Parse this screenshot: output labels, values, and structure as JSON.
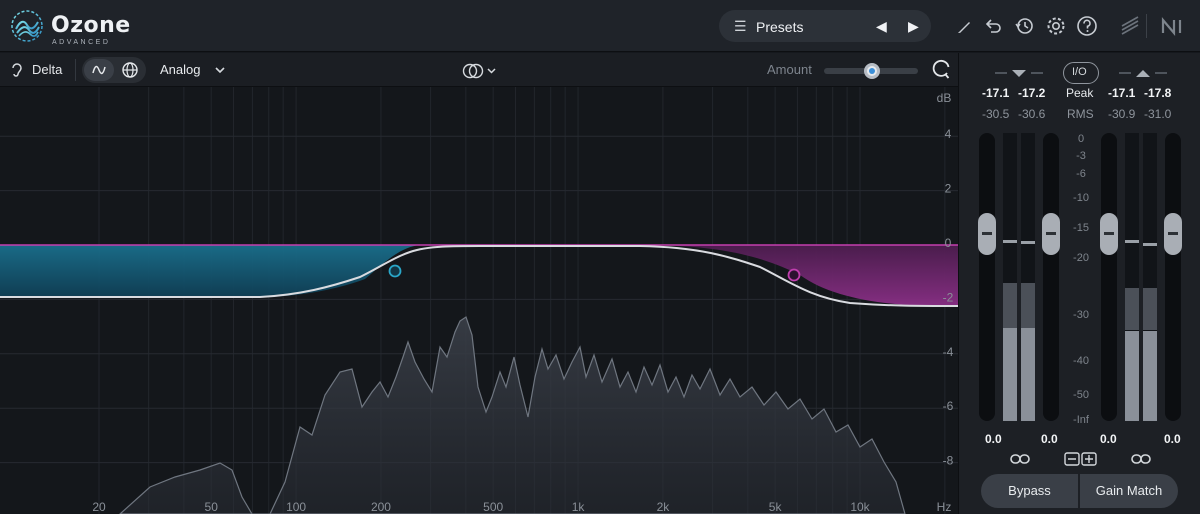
{
  "app": {
    "name": "Ozone",
    "edition": "ADVANCED"
  },
  "header": {
    "presets_label": "Presets",
    "icons": [
      "pencil-icon",
      "undo-icon",
      "history-icon",
      "settings-icon",
      "help-icon",
      "signal-chain-icon",
      "ni-logo-icon"
    ]
  },
  "module_toolbar": {
    "delta_label": "Delta",
    "mode_label": "Analog",
    "amount_label": "Amount",
    "amount_value": 0.5
  },
  "eq": {
    "db_unit": "dB",
    "db_labels": [
      "4",
      "2",
      "0",
      "-2",
      "-4",
      "-6",
      "-8"
    ],
    "hz_unit": "Hz",
    "freq_labels": [
      "20",
      "50",
      "100",
      "200",
      "500",
      "1k",
      "2k",
      "5k",
      "10k"
    ],
    "nodes": [
      {
        "type": "low-shelf",
        "freq_hz": 290,
        "gain_db": -1.3,
        "color": "#2aa7c9"
      },
      {
        "type": "high-shelf",
        "freq_hz": 6000,
        "gain_db": -1.4,
        "color": "#c03fae"
      }
    ],
    "colors": {
      "low": "#1d6b86",
      "high": "#b03aa6",
      "curve": "#d9dbe0"
    }
  },
  "meters": {
    "in": {
      "peak": [
        "-17.1",
        "-17.2"
      ],
      "rms": [
        "-30.5",
        "-30.6"
      ],
      "gain": [
        "0.0",
        "0.0"
      ]
    },
    "out": {
      "peak": [
        "-17.1",
        "-17.8"
      ],
      "rms": [
        "-30.9",
        "-31.0"
      ],
      "gain": [
        "0.0",
        "0.0"
      ]
    },
    "io_label": "I/O",
    "peak_label": "Peak",
    "rms_label": "RMS",
    "scale": [
      "0",
      "-3",
      "-6",
      "-10",
      "-15",
      "-20",
      "-30",
      "-40",
      "-50",
      "-Inf"
    ],
    "bypass_label": "Bypass",
    "gain_match_label": "Gain Match"
  }
}
